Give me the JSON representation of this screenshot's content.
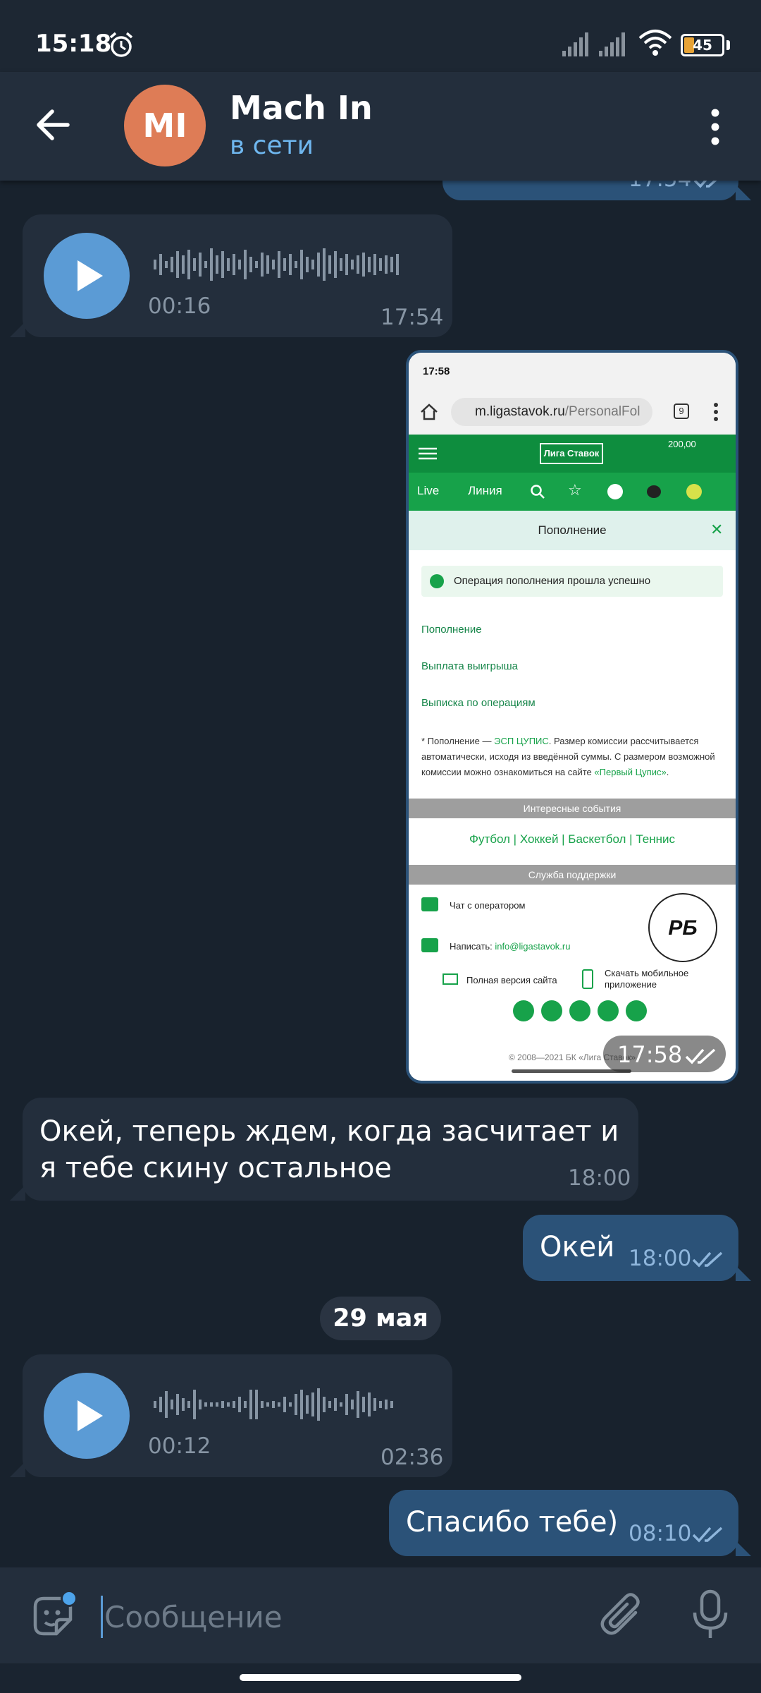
{
  "status_bar": {
    "time": "15:18",
    "battery": "45"
  },
  "header": {
    "avatar_initials": "MI",
    "name": "Mach In",
    "status": "в сети"
  },
  "messages": {
    "top_partial": {
      "time": "17:54"
    },
    "voice1": {
      "duration": "00:16",
      "time": "17:54"
    },
    "photo": {
      "time": "17:58",
      "screenshot": {
        "status_time": "17:58",
        "url_host": "m.ligastavok.ru",
        "url_path": "/PersonalFol",
        "tab_count": "9",
        "logo": "Лига Ставок",
        "balance": "200,00",
        "nav": [
          "Live",
          "Линия"
        ],
        "popup_title": "Пополнение",
        "success_text": "Операция пополнения прошла успешно",
        "links": [
          "Пополнение",
          "Выплата выигрыша",
          "Выписка по операциям"
        ],
        "note_part1": "* Пополнение — ",
        "note_link1": "ЭСП ЦУПИС",
        "note_part2": ". Размер комиссии рассчитывается автоматически, исходя из введённой суммы. С размером возможной комиссии можно ознакомиться на сайте ",
        "note_link2": "«Первый Цупис»",
        "note_part3": ".",
        "events_header": "Интересные события",
        "sports": "Футбол  |  Хоккей  |  Баскетбол  |  Теннис",
        "support_header": "Служба поддержки",
        "chat_operator": "Чат с оператором",
        "write_label": "Написать: ",
        "email": "info@ligastavok.ru",
        "badge": "РБ",
        "full_version": "Полная версия сайта",
        "download_app": "Скачать мобильное приложение",
        "copyright": "© 2008—2021 БК «Лига Ставок»"
      }
    },
    "text1": {
      "text": "Окей, теперь ждем, когда засчитает и я тебе скину остальное",
      "time": "18:00"
    },
    "text2": {
      "text": "Окей",
      "time": "18:00"
    },
    "date_separator": "29 мая",
    "voice2": {
      "duration": "00:12",
      "time": "02:36"
    },
    "text3": {
      "text": "Спасибо тебе)",
      "time": "08:10"
    }
  },
  "input": {
    "placeholder": "Сообщение"
  },
  "colors": {
    "background": "#18222d",
    "header": "#232e3c",
    "incoming_bubble": "#232e3c",
    "outgoing_bubble": "#2b5278",
    "accent": "#5b9bd5",
    "avatar": "#de7c56"
  }
}
